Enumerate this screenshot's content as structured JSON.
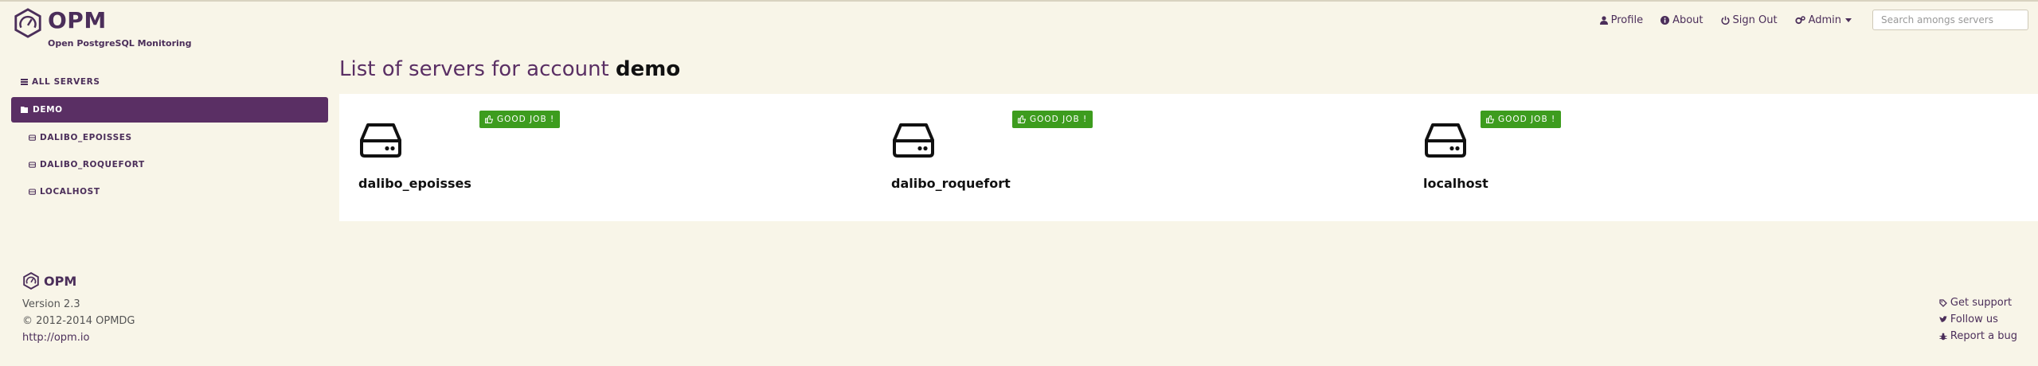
{
  "brand": {
    "title": "OPM",
    "subtitle": "Open PostgreSQL Monitoring",
    "logo_icon": "gauge-icon"
  },
  "topnav": {
    "profile": "Profile",
    "about": "About",
    "signout": "Sign Out",
    "admin": "Admin",
    "search_placeholder": "Search amongs servers"
  },
  "sidebar": {
    "items": [
      {
        "label": "ALL SERVERS",
        "icon": "list-icon"
      },
      {
        "label": "DEMO",
        "icon": "folder-open-icon"
      },
      {
        "label": "DALIBO_EPOISSES",
        "icon": "hdd-icon"
      },
      {
        "label": "DALIBO_ROQUEFORT",
        "icon": "hdd-icon"
      },
      {
        "label": "LOCALHOST",
        "icon": "hdd-icon"
      }
    ]
  },
  "main": {
    "title_prefix": "List of servers for account",
    "account": "demo",
    "servers": [
      {
        "name": "dalibo_epoisses",
        "status": "GOOD JOB !"
      },
      {
        "name": "dalibo_roquefort",
        "status": "GOOD JOB !"
      },
      {
        "name": "localhost",
        "status": "GOOD JOB !"
      }
    ]
  },
  "footer": {
    "brand": "OPM",
    "version": "Version 2.3",
    "copyright": "© 2012-2014 OPMDG",
    "url": "http://opm.io",
    "links": [
      "Get support",
      "Follow us",
      "Report a bug"
    ]
  },
  "colors": {
    "accent": "#5a2f64",
    "background": "#f8f5e8",
    "success": "#3d9c1e"
  }
}
